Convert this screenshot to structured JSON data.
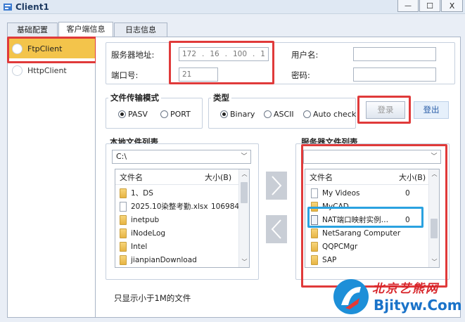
{
  "window": {
    "title": "Client1",
    "controls": {
      "minimize": "—",
      "maximize": "☐",
      "close": "X"
    }
  },
  "tabs": [
    {
      "label": "基础配置",
      "active": false
    },
    {
      "label": "客户端信息",
      "active": true
    },
    {
      "label": "日志信息",
      "active": false
    }
  ],
  "sidebar": {
    "items": [
      {
        "label": "FtpClient",
        "selected": true
      },
      {
        "label": "HttpClient",
        "selected": false
      }
    ]
  },
  "server": {
    "address_label": "服务器地址:",
    "ip": [
      "172",
      "16",
      "100",
      "1"
    ],
    "port_label": "端口号:",
    "port": "21",
    "username_label": "用户名:",
    "username": "",
    "password_label": "密码:",
    "password": ""
  },
  "transfer_mode": {
    "title": "文件传输模式",
    "options": [
      {
        "label": "PASV",
        "selected": true
      },
      {
        "label": "PORT",
        "selected": false
      }
    ]
  },
  "type": {
    "title": "类型",
    "options": [
      {
        "label": "Binary",
        "selected": true
      },
      {
        "label": "ASCII",
        "selected": false
      },
      {
        "label": "Auto check",
        "selected": false
      }
    ]
  },
  "buttons": {
    "login": "登录",
    "logout": "登出"
  },
  "local": {
    "title": "本地文件列表",
    "drive": "C:\\",
    "col_name": "文件名",
    "col_size": "大小(B)",
    "files": [
      {
        "name": "1、DS",
        "size": "",
        "kind": "folder"
      },
      {
        "name": "2025.10染整考勤.xlsx",
        "size": "106984",
        "kind": "file"
      },
      {
        "name": "inetpub",
        "size": "",
        "kind": "folder"
      },
      {
        "name": "iNodeLog",
        "size": "",
        "kind": "folder"
      },
      {
        "name": "Intel",
        "size": "",
        "kind": "folder"
      },
      {
        "name": "jianpianDownload",
        "size": "",
        "kind": "folder"
      }
    ]
  },
  "remote": {
    "title": "服务器文件列表",
    "path": "",
    "col_name": "文件名",
    "col_size": "大小(B)",
    "files": [
      {
        "name": "My Videos",
        "size": "0",
        "kind": "file"
      },
      {
        "name": "MyCAD",
        "size": "",
        "kind": "folder"
      },
      {
        "name": "NAT端口映射实例…",
        "size": "0",
        "kind": "doc"
      },
      {
        "name": "NetSarang Computer",
        "size": "",
        "kind": "folder"
      },
      {
        "name": "QQPCMgr",
        "size": "",
        "kind": "folder"
      },
      {
        "name": "SAP",
        "size": "",
        "kind": "folder"
      }
    ]
  },
  "footer_note": "只显示小于1M的文件",
  "watermark": {
    "line1": "北京艺熊网",
    "line2": "Bjityw.Com"
  },
  "colors": {
    "highlight_red": "#e03a3a",
    "highlight_blue": "#2aa2e0",
    "selected_item": "#f3c44b"
  }
}
